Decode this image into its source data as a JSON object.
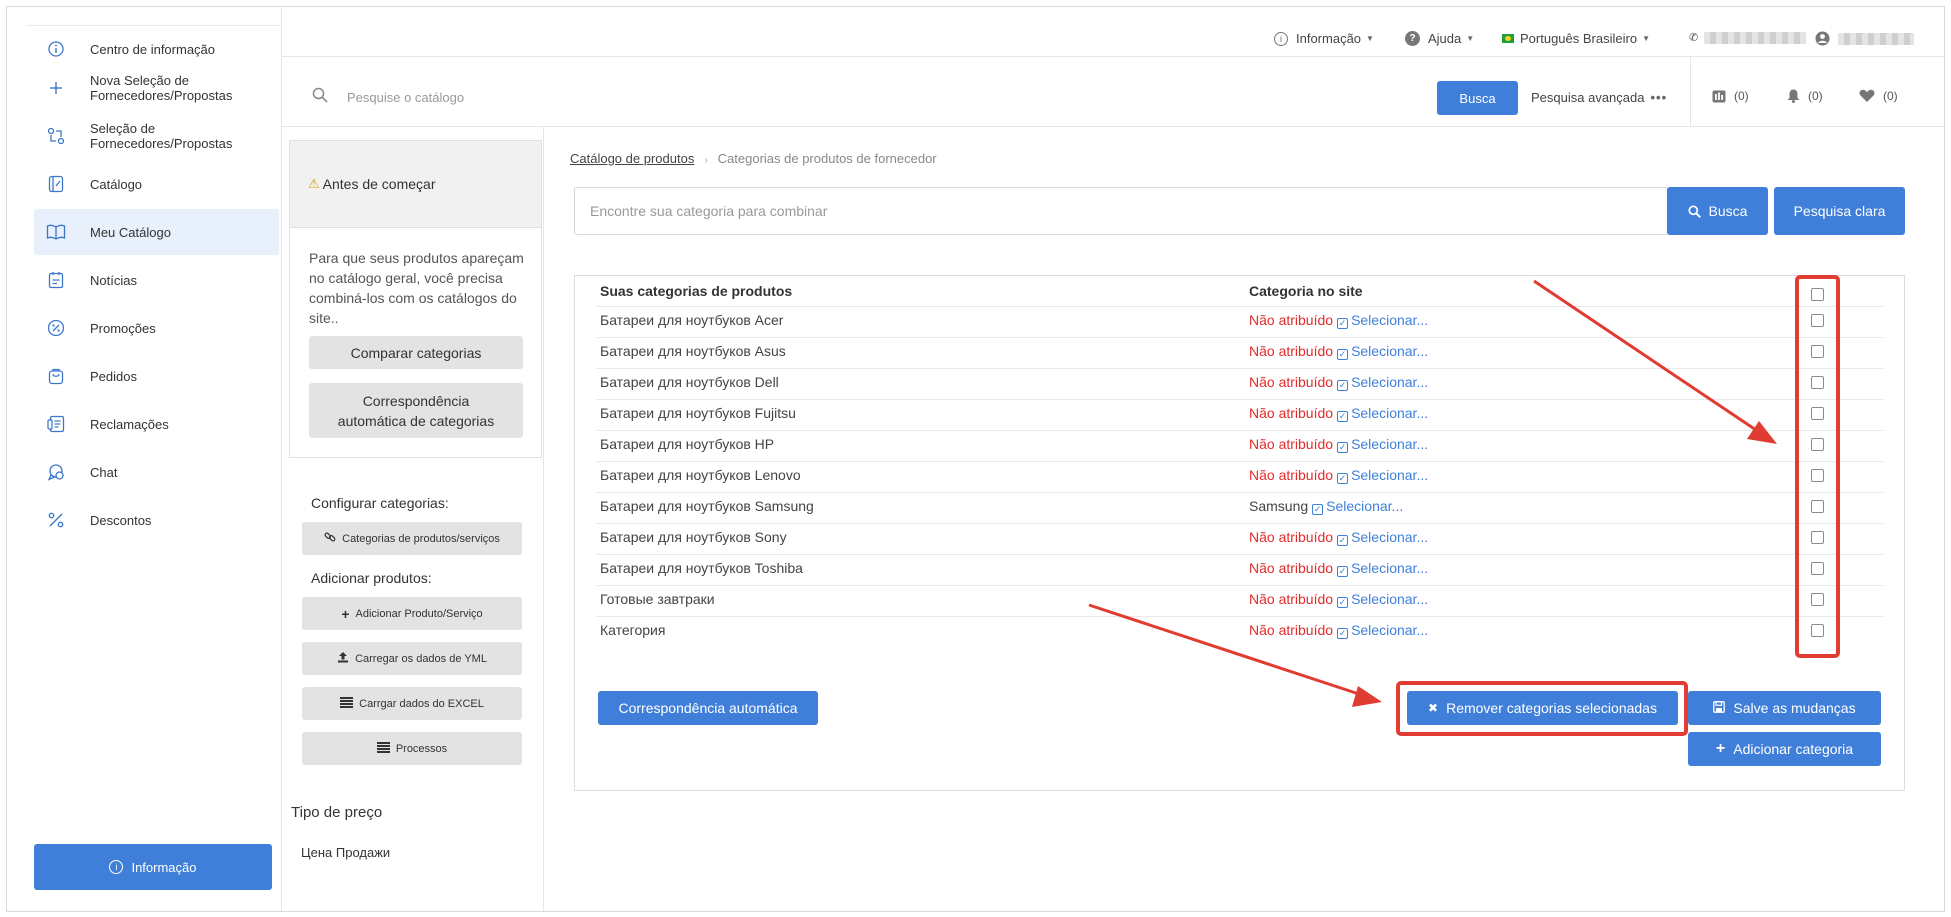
{
  "sidebar": {
    "items": [
      {
        "label_line1": "Centro de informação",
        "label_line2": "",
        "icon": "info-icon"
      },
      {
        "label_line1": "Nova Seleção de",
        "label_line2": "Fornecedores/Propostas",
        "icon": "plus-icon"
      },
      {
        "label_line1": "Seleção de",
        "label_line2": "Fornecedores/Propostas",
        "icon": "swap-icon"
      },
      {
        "label_line1": "Catálogo",
        "label_line2": "",
        "icon": "catalog-icon"
      },
      {
        "label_line1": "Meu Catálogo",
        "label_line2": "",
        "icon": "book-icon"
      },
      {
        "label_line1": "Notícias",
        "label_line2": "",
        "icon": "news-icon"
      },
      {
        "label_line1": "Promoções",
        "label_line2": "",
        "icon": "percent-badge-icon"
      },
      {
        "label_line1": "Pedidos",
        "label_line2": "",
        "icon": "bag-icon"
      },
      {
        "label_line1": "Reclamações",
        "label_line2": "",
        "icon": "complaint-icon"
      },
      {
        "label_line1": "Chat",
        "label_line2": "",
        "icon": "chat-icon"
      },
      {
        "label_line1": "Descontos",
        "label_line2": "",
        "icon": "percent-icon"
      }
    ],
    "info_button": "Informação"
  },
  "topbar": {
    "info": "Informação",
    "help": "Ajuda",
    "language": "Português Brasileiro"
  },
  "search": {
    "placeholder": "Pesquise o catálogo",
    "button": "Busca",
    "advanced": "Pesquisa avançada",
    "compare_count": "(0)",
    "notifications_count": "(0)",
    "favorites_count": "(0)"
  },
  "left_panel": {
    "before_title": "Antes de começar",
    "before_text": "Para que seus produtos apareçam no catálogo geral, você precisa combiná-los com os catálogos do site..",
    "compare_btn": "Comparar categorias",
    "auto_match_line1": "Correspondência",
    "auto_match_line2": "automática de categorias",
    "configure_label": "Configurar categorias:",
    "categories_btn": "Categorias de produtos/serviços",
    "add_products_label": "Adicionar produtos:",
    "add_product_btn": "Adicionar Produto/Serviço",
    "yml_btn": "Carregar os dados de YML",
    "excel_btn": "Carrgar dados do EXCEL",
    "processes_btn": "Processos",
    "price_type_label": "Tipo de preço",
    "price_type_value": "Цена Продажи"
  },
  "main": {
    "breadcrumb": {
      "parent": "Catálogo de produtos",
      "current": "Categorias de produtos de fornecedor"
    },
    "search_placeholder": "Encontre sua categoria para combinar",
    "search_btn": "Busca",
    "clear_btn": "Pesquisa clara",
    "table": {
      "headers": {
        "name": "Suas categorias de produtos",
        "category": "Categoria no site"
      },
      "select_label": "Selecionar...",
      "rows": [
        {
          "name": "Батареи для ноутбуков Acer",
          "category": "Não atribuído",
          "assigned": false
        },
        {
          "name": "Батареи для ноутбуков Asus",
          "category": "Não atribuído",
          "assigned": false
        },
        {
          "name": "Батареи для ноутбуков Dell",
          "category": "Não atribuído",
          "assigned": false
        },
        {
          "name": "Батареи для ноутбуков Fujitsu",
          "category": "Não atribuído",
          "assigned": false
        },
        {
          "name": "Батареи для ноутбуков HP",
          "category": "Não atribuído",
          "assigned": false
        },
        {
          "name": "Батареи для ноутбуков Lenovo",
          "category": "Não atribuído",
          "assigned": false
        },
        {
          "name": "Батареи для ноутбуков Samsung",
          "category": "Samsung",
          "assigned": true
        },
        {
          "name": "Батареи для ноутбуков Sony",
          "category": "Não atribuído",
          "assigned": false
        },
        {
          "name": "Батареи для ноутбуков Toshiba",
          "category": "Não atribuído",
          "assigned": false
        },
        {
          "name": "Готовые завтраки",
          "category": "Não atribuído",
          "assigned": false
        },
        {
          "name": "Категория",
          "category": "Não atribuído",
          "assigned": false
        }
      ]
    },
    "auto_btn": "Correspondência automática",
    "remove_btn": "Remover categorias selecionadas",
    "save_btn": "Salve as mudanças",
    "add_btn": "Adicionar categoria"
  },
  "colors": {
    "accent": "#3f7fd9",
    "unassigned": "#e52b2b",
    "highlight": "#e03c31"
  }
}
